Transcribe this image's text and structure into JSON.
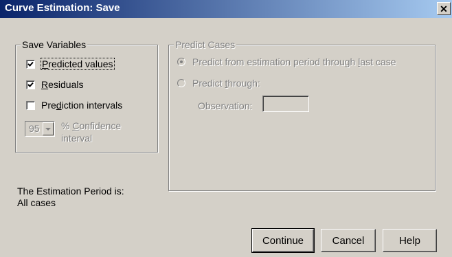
{
  "window": {
    "title": "Curve Estimation: Save",
    "close_glyph": "✕"
  },
  "save_variables": {
    "legend": "Save Variables",
    "predicted_values": {
      "label_pre": "",
      "label_ul": "P",
      "label_post": "redicted values",
      "checked": true
    },
    "residuals": {
      "label_pre": "",
      "label_ul": "R",
      "label_post": "esiduals",
      "checked": true
    },
    "prediction_intervals": {
      "label_pre": "Pre",
      "label_ul": "d",
      "label_post": "iction intervals",
      "checked": false
    },
    "confidence": {
      "value": "95",
      "label_line1_pre": "% ",
      "label_line1_ul": "C",
      "label_line1_post": "onfidence",
      "label_line2": "interval"
    }
  },
  "predict_cases": {
    "legend": "Predict Cases",
    "option1": {
      "label_pre": "Predict from estimation period through ",
      "label_ul": "l",
      "label_post": "ast case",
      "selected": true
    },
    "option2": {
      "label_pre": "Predict ",
      "label_ul": "t",
      "label_post": "hrough:",
      "selected": false
    },
    "observation_label": "Observation:",
    "observation_value": ""
  },
  "estimation_period": {
    "line1": "The Estimation Period is:",
    "line2": "All cases"
  },
  "buttons": {
    "continue": "Continue",
    "cancel": "Cancel",
    "help": "Help"
  }
}
